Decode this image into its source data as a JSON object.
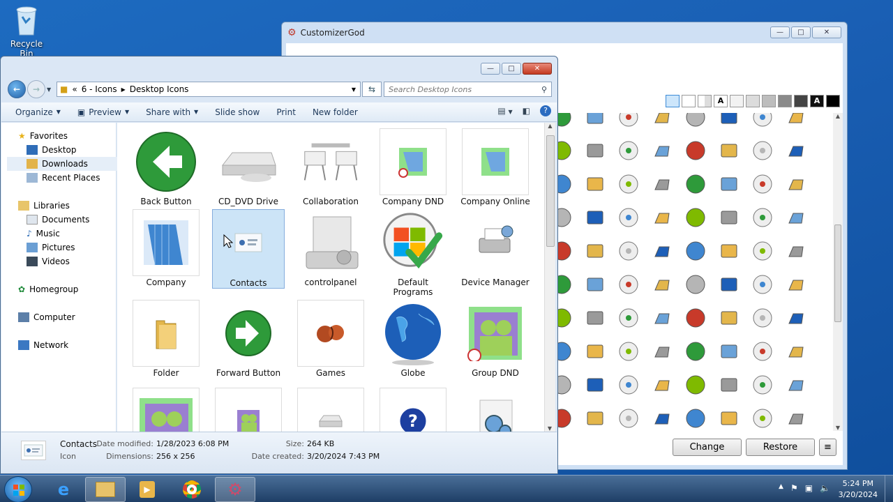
{
  "desktop": {
    "recycle_bin": "Recycle Bin"
  },
  "customizer": {
    "title": "CustomizerGod",
    "swatches": [
      "",
      "",
      "",
      "A",
      "",
      "",
      "",
      "",
      "",
      "A",
      ""
    ],
    "buttons": {
      "change": "Change",
      "restore": "Restore",
      "menu": "≡"
    }
  },
  "explorer": {
    "breadcrumb": {
      "prefix": "«",
      "parent": "6 - Icons",
      "current": "Desktop Icons"
    },
    "search_placeholder": "Search Desktop Icons",
    "toolbar": {
      "organize": "Organize",
      "preview": "Preview",
      "share_with": "Share with",
      "slide_show": "Slide show",
      "print": "Print",
      "new_folder": "New folder"
    },
    "nav": {
      "favorites": "Favorites",
      "desktop": "Desktop",
      "downloads": "Downloads",
      "recent_places": "Recent Places",
      "libraries": "Libraries",
      "documents": "Documents",
      "music": "Music",
      "pictures": "Pictures",
      "videos": "Videos",
      "homegroup": "Homegroup",
      "computer": "Computer",
      "network": "Network"
    },
    "items": [
      {
        "label": "Back Button"
      },
      {
        "label": "CD_DVD Drive"
      },
      {
        "label": "Collaboration"
      },
      {
        "label": "Company DND"
      },
      {
        "label": "Company Online"
      },
      {
        "label": "Company"
      },
      {
        "label": "Contacts"
      },
      {
        "label": "controlpanel"
      },
      {
        "label": "Default Programs"
      },
      {
        "label": "Device Manager"
      },
      {
        "label": "Folder"
      },
      {
        "label": "Forward Button"
      },
      {
        "label": "Games"
      },
      {
        "label": "Globe"
      },
      {
        "label": "Group DND"
      },
      {
        "label": ""
      },
      {
        "label": ""
      },
      {
        "label": ""
      },
      {
        "label": ""
      },
      {
        "label": ""
      }
    ],
    "details": {
      "name": "Contacts",
      "type": "Icon",
      "date_modified_label": "Date modified:",
      "date_modified": "1/28/2023 6:08 PM",
      "dimensions_label": "Dimensions:",
      "dimensions": "256 x 256",
      "size_label": "Size:",
      "size": "264 KB",
      "date_created_label": "Date created:",
      "date_created": "3/20/2024 7:43 PM"
    }
  },
  "taskbar": {
    "time": "5:24 PM",
    "date": "3/20/2024"
  }
}
